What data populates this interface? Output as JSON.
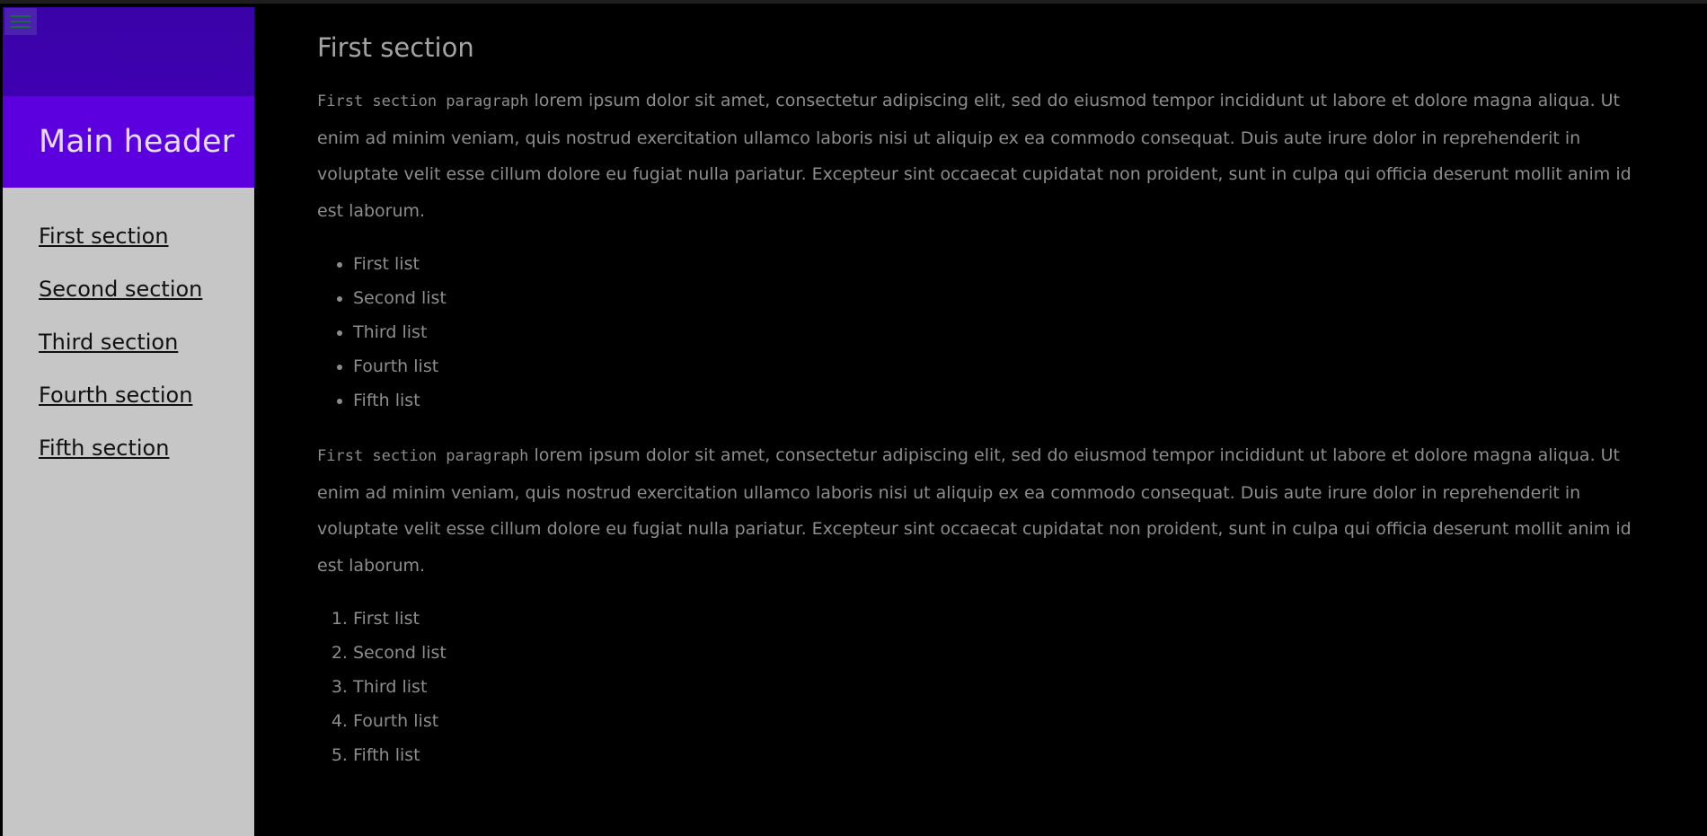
{
  "sidebar": {
    "menu_icon": "hamburger-menu-icon",
    "header": "Main header",
    "nav_items": [
      {
        "label": "First section"
      },
      {
        "label": "Second section"
      },
      {
        "label": "Third section"
      },
      {
        "label": "Fourth section"
      },
      {
        "label": "Fifth section"
      }
    ]
  },
  "main": {
    "title": "First section",
    "paragraph1": {
      "code": "First section paragraph",
      "text": " lorem ipsum dolor sit amet, consectetur adipiscing elit, sed do eiusmod tempor incididunt ut labore et dolore magna aliqua. Ut enim ad minim veniam, quis nostrud exercitation ullamco laboris nisi ut aliquip ex ea commodo consequat. Duis aute irure dolor in reprehenderit in voluptate velit esse cillum dolore eu fugiat nulla pariatur. Excepteur sint occaecat cupidatat non proident, sunt in culpa qui officia deserunt mollit anim id est laborum."
    },
    "unordered_list": [
      "First list",
      "Second list",
      "Third list",
      "Fourth list",
      "Fifth list"
    ],
    "paragraph2": {
      "code": "First section paragraph",
      "text": " lorem ipsum dolor sit amet, consectetur adipiscing elit, sed do eiusmod tempor incididunt ut labore et dolore magna aliqua. Ut enim ad minim veniam, quis nostrud exercitation ullamco laboris nisi ut aliquip ex ea commodo consequat. Duis aute irure dolor in reprehenderit in voluptate velit esse cillum dolore eu fugiat nulla pariatur. Excepteur sint occaecat cupidatat non proident, sunt in culpa qui officia deserunt mollit anim id est laborum."
    },
    "ordered_list": [
      "First list",
      "Second list",
      "Third list",
      "Fourth list",
      "Fifth list"
    ]
  },
  "colors": {
    "background": "#000000",
    "sidebar_bg": "#c6c6c6",
    "sidebar_top": "#3f00b2",
    "header_bg": "#5d00e0",
    "text": "#8d8d8d"
  }
}
